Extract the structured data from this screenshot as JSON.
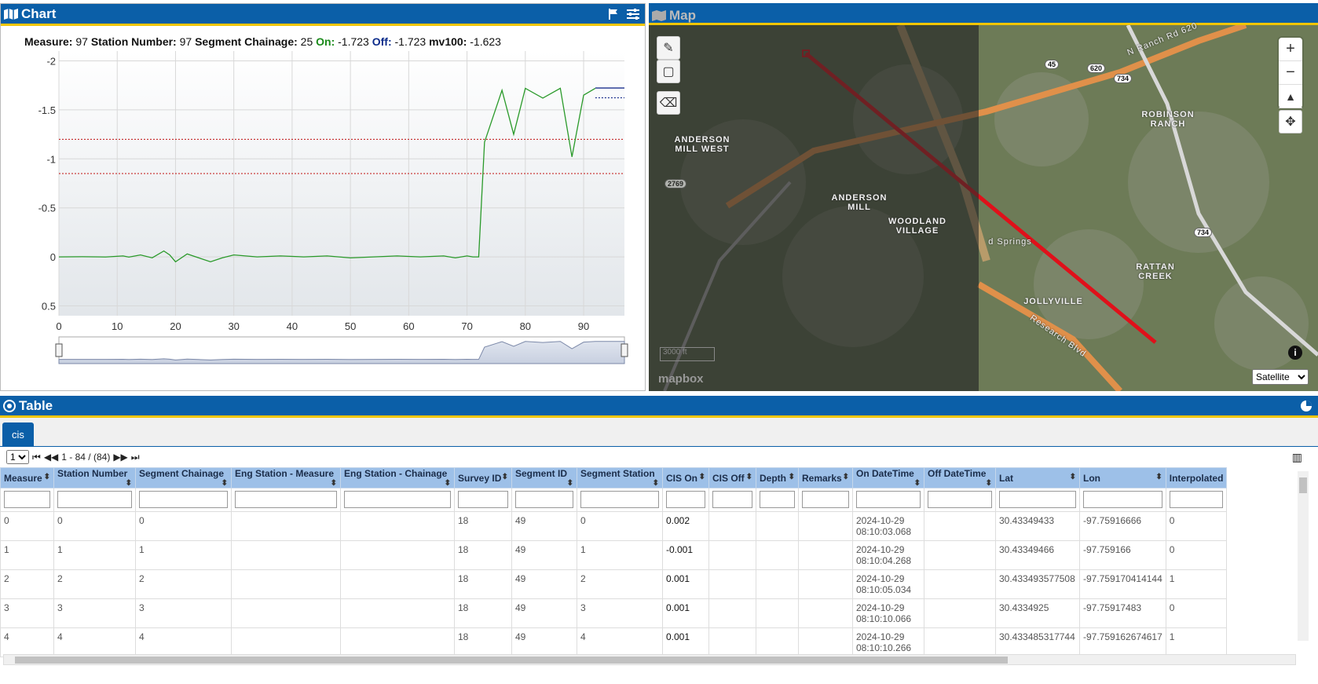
{
  "chart_panel": {
    "title": "Chart"
  },
  "map_panel": {
    "title": "Map",
    "basemap_option": "Satellite",
    "scale_label": "3000 ft",
    "attribution": "mapbox"
  },
  "table_panel": {
    "title": "Table",
    "tab_label": "cis"
  },
  "readout": {
    "measure_label": "Measure:",
    "measure_value": "97",
    "station_label": "Station Number:",
    "station_value": "97",
    "chainage_label": "Segment Chainage:",
    "chainage_value": "25",
    "on_label": "On:",
    "on_value": "-1.723",
    "off_label": "Off:",
    "off_value": "-1.723",
    "mv_label": "mv100:",
    "mv_value": "-1.623"
  },
  "chart_data": {
    "type": "line",
    "xlim": [
      0,
      97
    ],
    "ylim": [
      0.6,
      -2.1
    ],
    "y_inverted": true,
    "x_ticks": [
      0,
      10,
      20,
      30,
      40,
      50,
      60,
      70,
      80,
      90
    ],
    "y_ticks": [
      -2,
      -1.5,
      -1,
      -0.5,
      0,
      0.5
    ],
    "y_tick_labels": [
      "-2",
      "-1.5",
      "-1",
      "-0.5",
      "0",
      "0.5"
    ],
    "reference_lines": [
      -1.2,
      -0.85
    ],
    "series": [
      {
        "color": "#2a9a2a",
        "x": [
          0,
          4,
          8,
          11,
          12,
          14,
          16,
          18,
          19,
          20,
          22,
          24,
          26,
          28,
          30,
          34,
          38,
          42,
          46,
          50,
          54,
          58,
          62,
          66,
          68,
          70,
          71,
          72,
          73,
          76,
          78,
          80,
          83,
          86,
          88,
          90,
          92
        ],
        "y": [
          0,
          -0.002,
          0.001,
          -0.01,
          0.002,
          -0.02,
          0.01,
          -0.06,
          -0.02,
          0.05,
          -0.03,
          0.01,
          0.05,
          0.01,
          -0.02,
          0,
          -0.01,
          0,
          -0.01,
          0.01,
          0,
          -0.01,
          0,
          -0.01,
          0.01,
          -0.01,
          0,
          0,
          -1.17,
          -1.7,
          -1.25,
          -1.72,
          -1.62,
          -1.72,
          -1.02,
          -1.65,
          -1.72
        ]
      },
      {
        "color": "#1a2f8c",
        "x": [
          92,
          97
        ],
        "y": [
          -1.723,
          -1.723
        ]
      },
      {
        "color": "#1a2f8c",
        "dashed": true,
        "x": [
          92,
          97
        ],
        "y": [
          -1.623,
          -1.623
        ]
      }
    ]
  },
  "pager": {
    "page_value": "1",
    "range_text": "1 - 84 / (84)"
  },
  "columns": [
    "Measure",
    "Station Number",
    "Segment Chainage",
    "Eng Station - Measure",
    "Eng Station - Chainage",
    "Survey ID",
    "Segment ID",
    "Segment Station",
    "CIS On",
    "CIS Off",
    "Depth",
    "Remarks",
    "On DateTime",
    "Off DateTime",
    "Lat",
    "Lon",
    "Interpolated"
  ],
  "rows": [
    [
      "0",
      "0",
      "0",
      "",
      "",
      "18",
      "49",
      "0",
      "0.002",
      "",
      "",
      "",
      "2024-10-29 08:10:03.068",
      "",
      "30.43349433",
      "-97.75916666",
      "0"
    ],
    [
      "1",
      "1",
      "1",
      "",
      "",
      "18",
      "49",
      "1",
      "-0.001",
      "",
      "",
      "",
      "2024-10-29 08:10:04.268",
      "",
      "30.43349466",
      "-97.759166",
      "0"
    ],
    [
      "2",
      "2",
      "2",
      "",
      "",
      "18",
      "49",
      "2",
      "0.001",
      "",
      "",
      "",
      "2024-10-29 08:10:05.034",
      "",
      "30.433493577508",
      "-97.759170414144",
      "1"
    ],
    [
      "3",
      "3",
      "3",
      "",
      "",
      "18",
      "49",
      "3",
      "0.001",
      "",
      "",
      "",
      "2024-10-29 08:10:10.066",
      "",
      "30.4334925",
      "-97.75917483",
      "0"
    ],
    [
      "4",
      "4",
      "4",
      "",
      "",
      "18",
      "49",
      "4",
      "0.001",
      "",
      "",
      "",
      "2024-10-29 08:10:10.266",
      "",
      "30.433485317744",
      "-97.759162674617",
      "1"
    ]
  ],
  "map_labels": {
    "anderson_mill_west": "ANDERSON MILL WEST",
    "anderson_mill": "ANDERSON MILL",
    "woodland_village": "WOODLAND VILLAGE",
    "robinson_ranch": "ROBINSON RANCH",
    "rattan_creek": "RATTAN CREEK",
    "jollyville": "JOLLYVILLE",
    "springs": "d Springs",
    "research_blvd": "Research Blvd",
    "ranch_rd": "N Ranch Rd 620",
    "shield_620": "620",
    "shield_45": "45",
    "shield_734": "734",
    "shield_2769": "2769"
  }
}
